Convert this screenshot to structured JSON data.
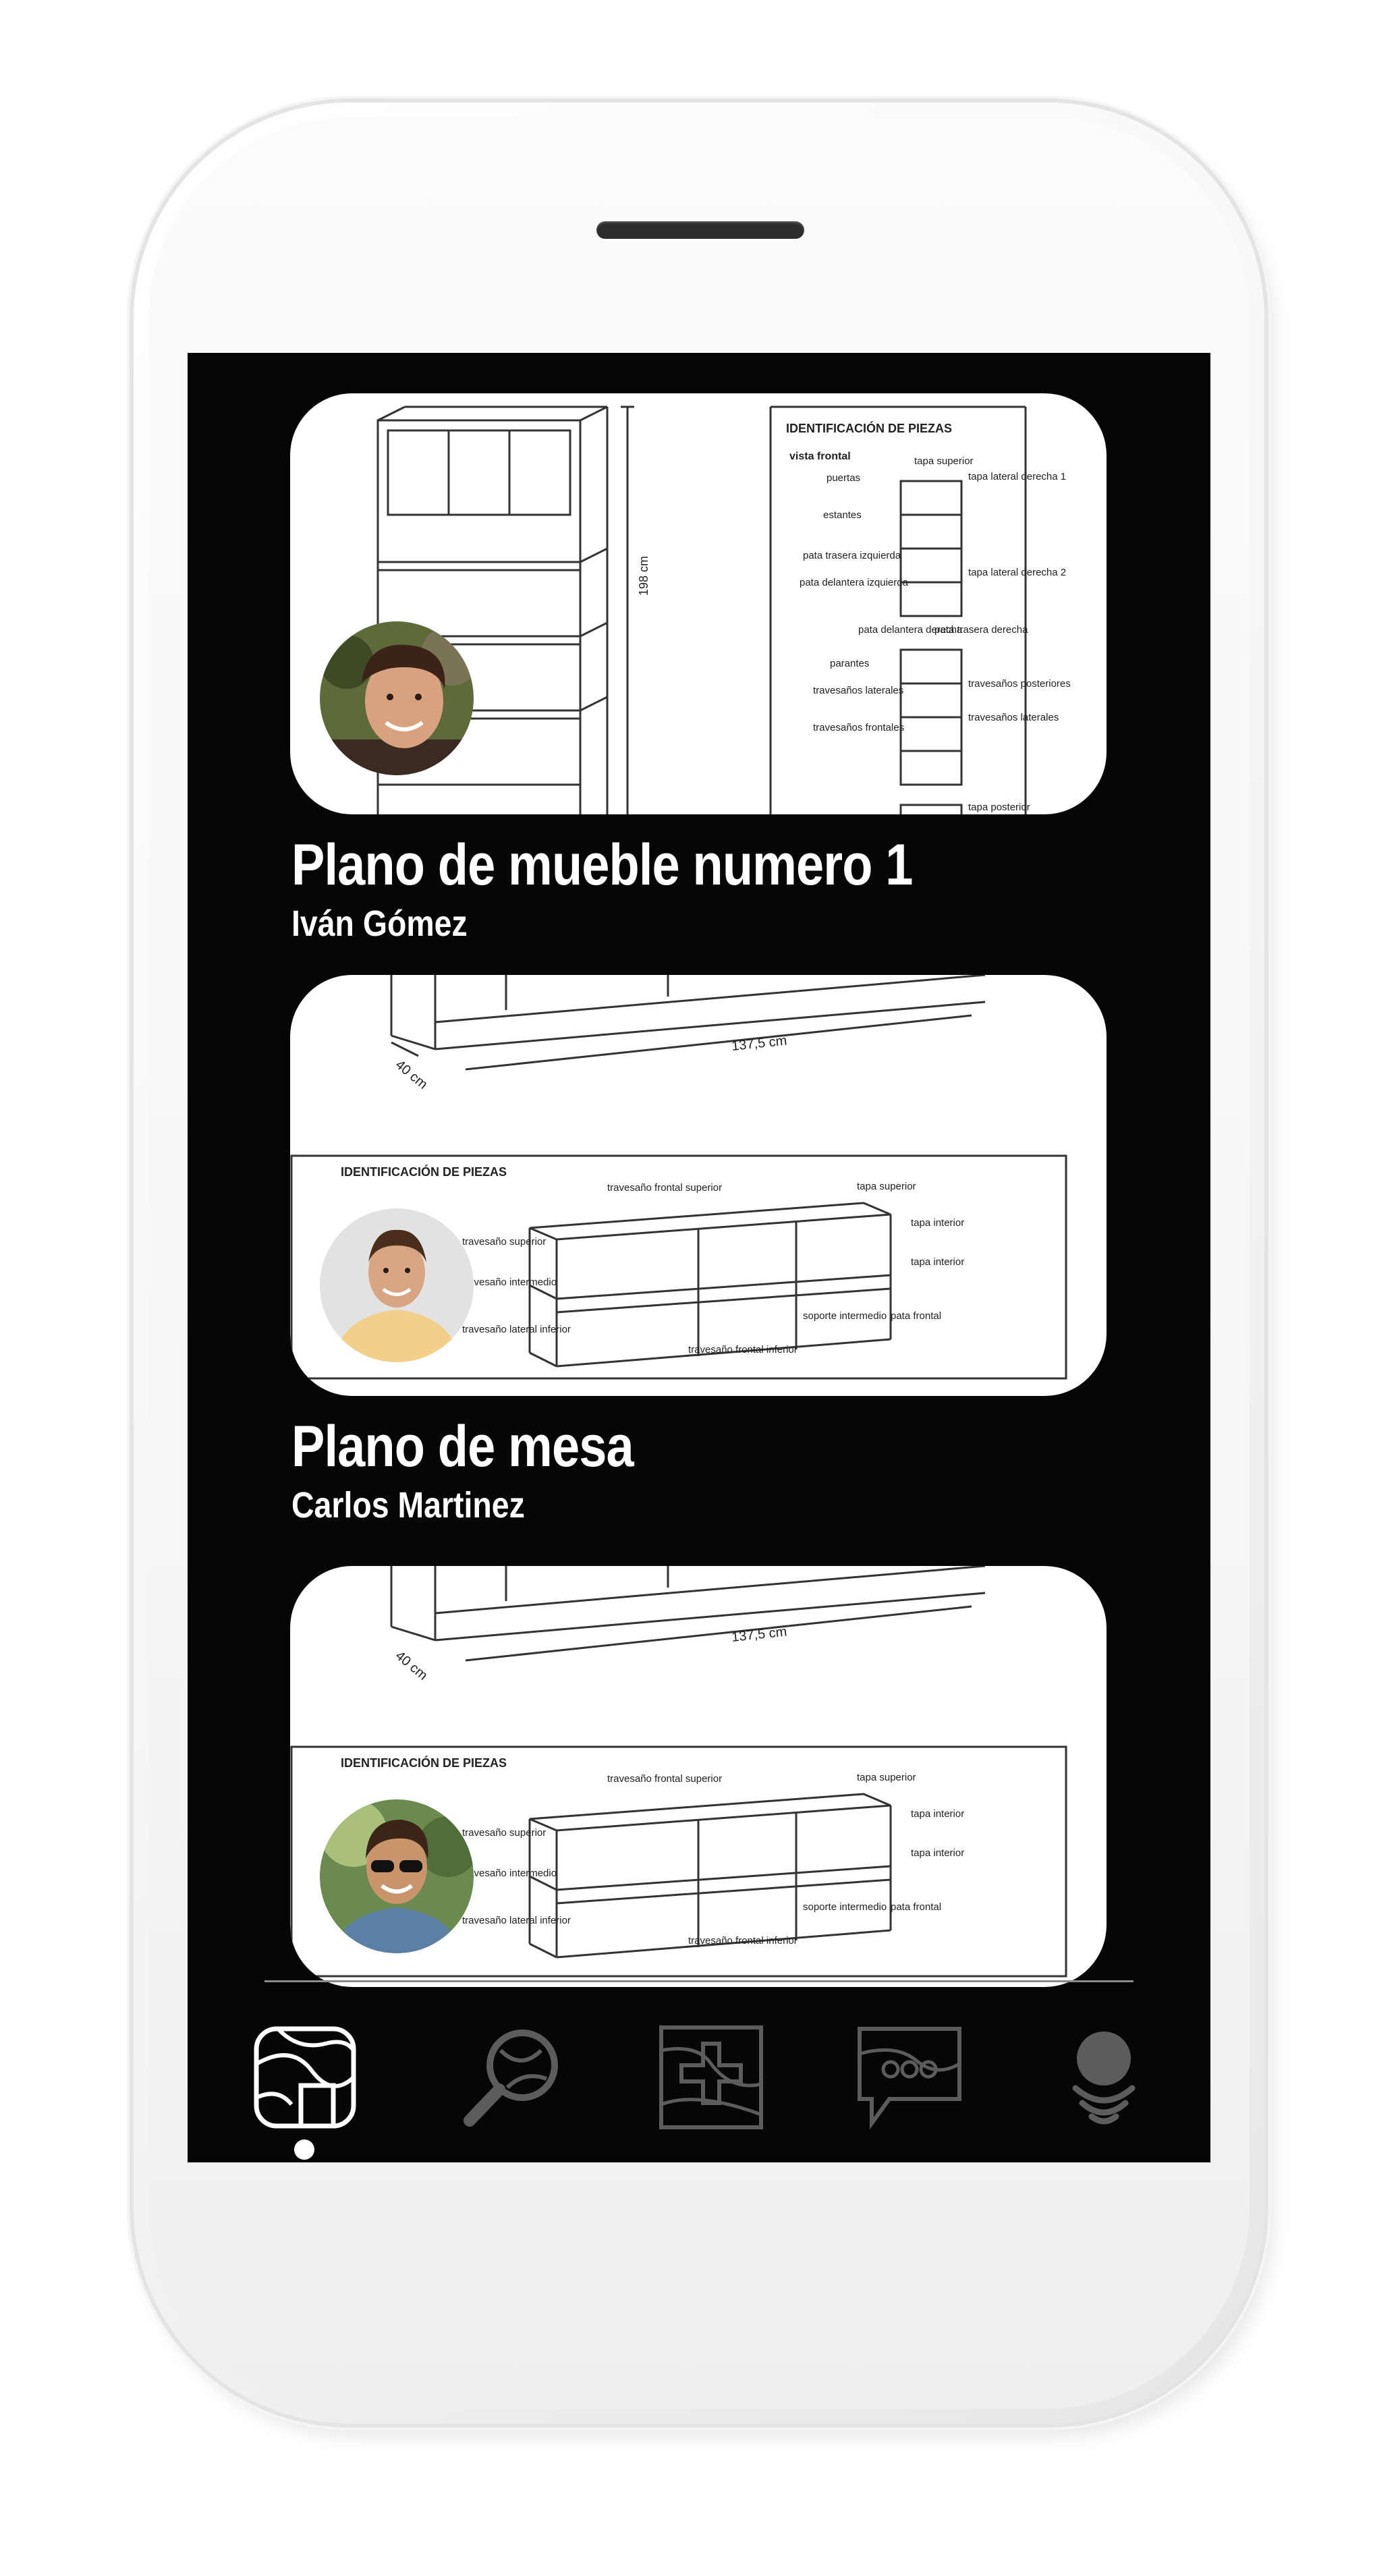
{
  "feed": {
    "items": [
      {
        "title": "Plano de mueble numero 1",
        "author": "Iván Gómez",
        "drawing_labels": {
          "heading": "IDENTIFICACIÓN DE PIEZAS",
          "subheading": "vista frontal",
          "dimension": "198 cm",
          "parts": [
            "tapa superior",
            "puertas",
            "tapa lateral derecha 1",
            "estantes",
            "pata trasera izquierda",
            "tapa lateral derecha 2",
            "pata delantera izquierda",
            "pata delantera derecha",
            "pata trasera derecha",
            "parantes",
            "travesaños laterales",
            "travesaños posteriores",
            "travesaños frontales",
            "travesaños laterales",
            "tapa posterior"
          ]
        }
      },
      {
        "title": "Plano de mesa",
        "author": "Carlos Martinez",
        "drawing_labels": {
          "heading": "IDENTIFICACIÓN DE PIEZAS",
          "dim_depth": "40 cm",
          "dim_width": "137,5 cm",
          "parts": [
            "travesaño frontal superior",
            "tapa superior",
            "tapa interior",
            "tapa interior",
            "travesaño superior",
            "travesaño intermedio",
            "travesaño lateral inferior",
            "soporte intermedio",
            "pata frontal",
            "travesaño frontal inferior"
          ]
        }
      },
      {
        "title": "",
        "author": "",
        "drawing_labels": {
          "heading": "IDENTIFICACIÓN DE PIEZAS",
          "dim_depth": "40 cm",
          "dim_width": "137,5 cm",
          "parts": [
            "travesaño frontal superior",
            "tapa superior",
            "tapa interior",
            "tapa interior",
            "travesaño superior",
            "travesaño intermedio",
            "travesaño lateral inferior",
            "soporte intermedio",
            "pata frontal",
            "travesaño frontal inferior"
          ]
        }
      }
    ]
  },
  "bottom_nav": {
    "items": [
      {
        "icon": "home-plans-icon",
        "active": true
      },
      {
        "icon": "search-icon",
        "active": false
      },
      {
        "icon": "add-plan-icon",
        "active": false
      },
      {
        "icon": "chat-icon",
        "active": false
      },
      {
        "icon": "profile-icon",
        "active": false
      }
    ]
  },
  "colors": {
    "screen_bg": "#060606",
    "text": "#ffffff",
    "nav_active": "#ffffff",
    "nav_inactive": "#5c5c5c"
  }
}
